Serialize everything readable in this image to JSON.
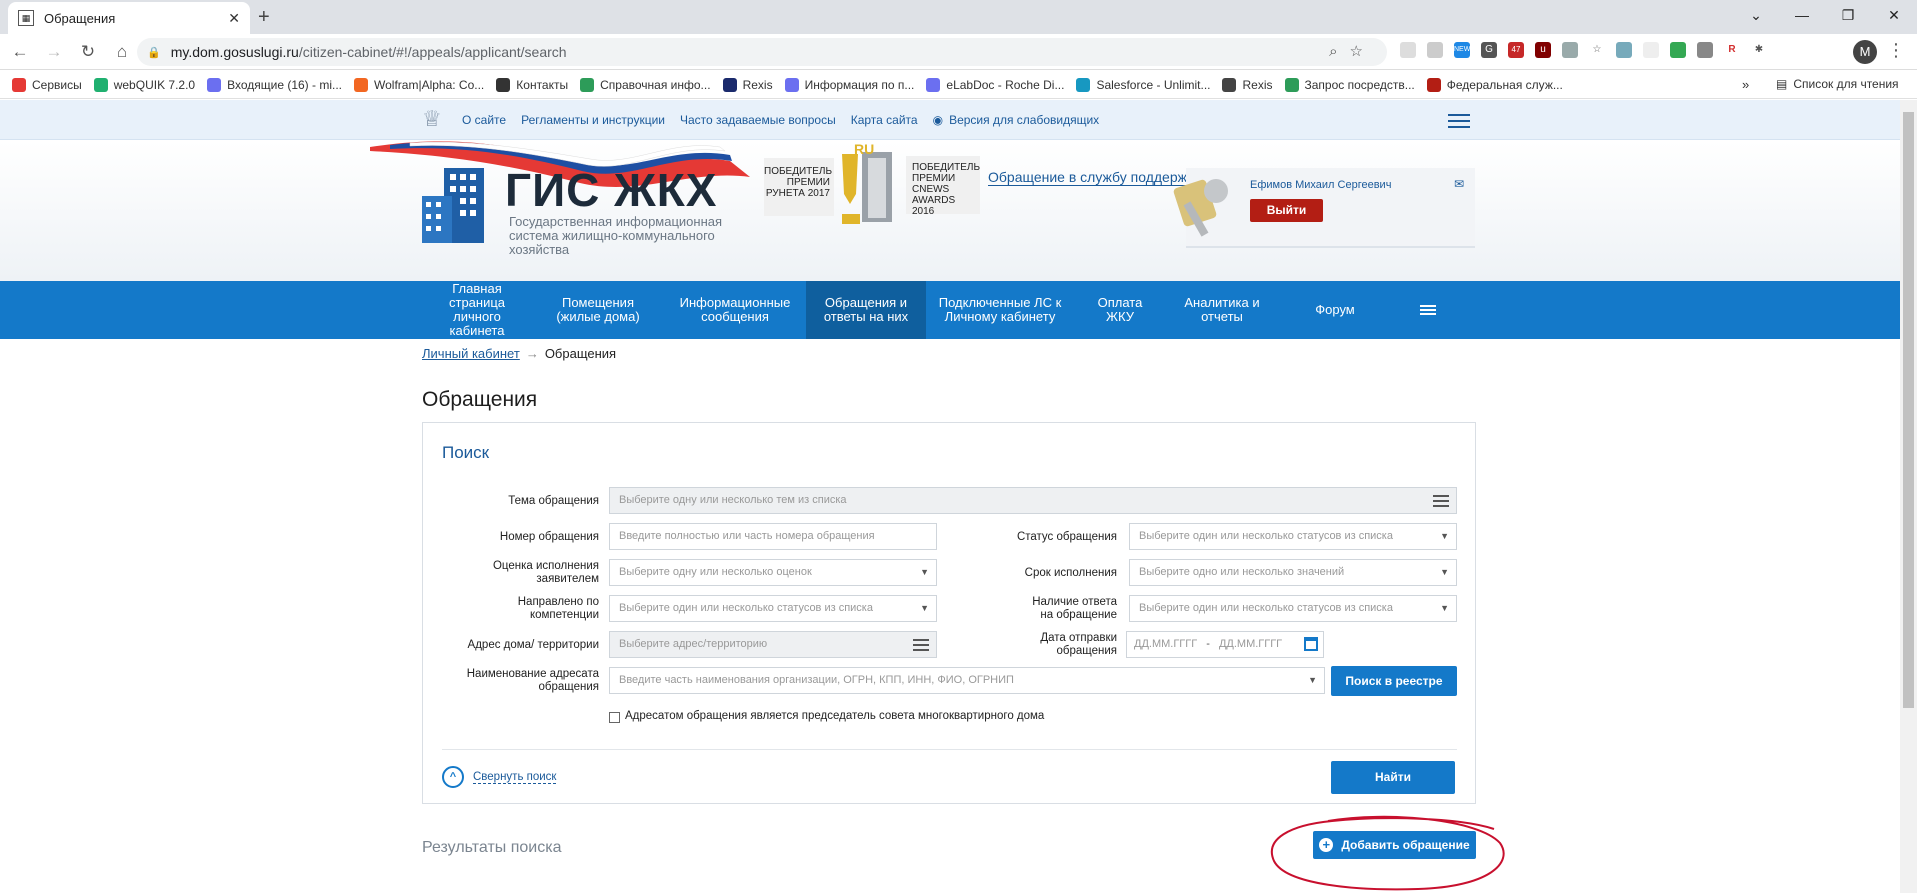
{
  "browser": {
    "tab_title": "Обращения",
    "url_host": "my.dom.gosuslugi.ru",
    "url_path": "/citizen-cabinet/#!/appeals/applicant/search",
    "profile_initial": "M",
    "ext_badge_new": "NEW",
    "ext_badge_count": "47",
    "bookmarks": [
      {
        "label": "Сервисы",
        "color": "#e53935"
      },
      {
        "label": "webQUIK 7.2.0",
        "color": "#20b070"
      },
      {
        "label": "Входящие (16) - mi...",
        "color": "#6b6ff0"
      },
      {
        "label": "Wolfram|Alpha: Co...",
        "color": "#f26722"
      },
      {
        "label": "Контакты",
        "color": "#333333"
      },
      {
        "label": "Справочная инфо...",
        "color": "#2d9c59"
      },
      {
        "label": "Rexis",
        "color": "#1a2a6c"
      },
      {
        "label": "Информация по п...",
        "color": "#6b6ff0"
      },
      {
        "label": "eLabDoc - Roche Di...",
        "color": "#6b6ff0"
      },
      {
        "label": "Salesforce - Unlimit...",
        "color": "#1798c1"
      },
      {
        "label": "Rexis",
        "color": "#444444"
      },
      {
        "label": "Запрос посредств...",
        "color": "#2d9c59"
      },
      {
        "label": "Федеральная служ...",
        "color": "#b31e14"
      }
    ],
    "bookmarks_more": "»",
    "reading_list": "Список для чтения"
  },
  "site": {
    "top_links": [
      "О сайте",
      "Регламенты и инструкции",
      "Часто задаваемые вопросы",
      "Карта сайта"
    ],
    "accessibility_link": "Версия для слабовидящих",
    "logo_title": "ГИС ЖКХ",
    "logo_subtitle": "Государственная информационная система жилищно-коммунального хозяйства",
    "award1": "ПОБЕДИТЕЛЬ ПРЕМИИ РУНЕТА 2017",
    "award2": "ПОБЕДИТЕЛЬ ПРЕМИИ CNEWS AWARDS 2016",
    "trophy_label": "RU",
    "support_link": "Обращение в службу поддержки",
    "user_name": "Ефимов Михаил Сергеевич",
    "logout": "Выйти"
  },
  "nav": {
    "items": [
      {
        "label": "Главная страница личного кабинета",
        "w": 110
      },
      {
        "label": "Помещения (жилые дома)",
        "w": 132
      },
      {
        "label": "Информационные сообщения",
        "w": 142
      },
      {
        "label": "Обращения и ответы на них",
        "w": 120
      },
      {
        "label": "Подключенные ЛС к Личному кабинету",
        "w": 148
      },
      {
        "label": "Оплата ЖКУ",
        "w": 92
      },
      {
        "label": "Аналитика и отчеты",
        "w": 112
      },
      {
        "label": "Форум",
        "w": 114
      }
    ]
  },
  "breadcrumb": {
    "link": "Личный кабинет",
    "sep": "→",
    "current": "Обращения"
  },
  "page_title": "Обращения",
  "search": {
    "title": "Поиск",
    "subject_label": "Тема обращения",
    "subject_placeholder": "Выберите одну или несколько тем из списка",
    "number_label": "Номер обращения",
    "number_placeholder": "Введите полностью или часть номера обращения",
    "status_label": "Статус обращения",
    "status_placeholder": "Выберите один или несколько статусов из списка",
    "rating_label": "Оценка исполнения заявителем",
    "rating_placeholder": "Выберите одну или несколько оценок",
    "deadline_label": "Срок исполнения",
    "deadline_placeholder": "Выберите одно или несколько значений",
    "competence_label": "Направлено по компетенции",
    "competence_placeholder": "Выберите один или несколько статусов из списка",
    "answer_label": "Наличие ответа на обращение",
    "answer_placeholder": "Выберите один или несколько статусов из списка",
    "address_label": "Адрес дома/ территории",
    "address_placeholder": "Выберите адрес/территорию",
    "send_date_label": "Дата отправки обращения",
    "date_from_placeholder": "ДД.ММ.ГГГГ",
    "date_sep": "-",
    "date_to_placeholder": "ДД.ММ.ГГГГ",
    "addressee_label": "Наименование адресата обращения",
    "addressee_placeholder": "Введите часть наименования организации, ОГРН, КПП, ИНН, ФИО, ОГРНИП",
    "registry_button": "Поиск в реестре",
    "checkbox_label": "Адресатом обращения является председатель совета многоквартирного дома",
    "checkbox_checked": false,
    "collapse_link": "Свернуть поиск",
    "find_button": "Найти"
  },
  "results": {
    "title": "Результаты поиска",
    "add_button": "Добавить обращение"
  },
  "colors": {
    "accent": "#1479c9",
    "logout": "#b31e14",
    "annotation": "#c8102e"
  }
}
